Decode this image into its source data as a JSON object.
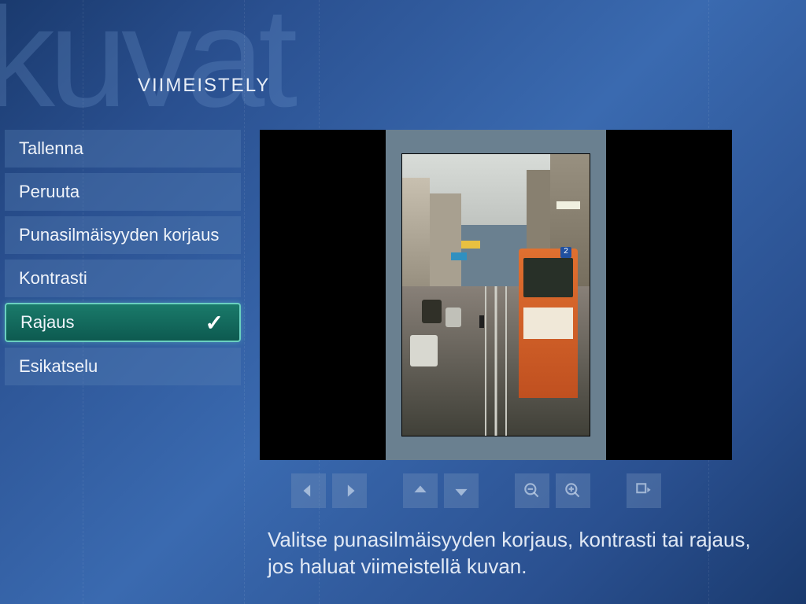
{
  "watermark": "kuvat",
  "pageTitle": "VIIMEISTELY",
  "sidebar": {
    "items": [
      {
        "label": "Tallenna",
        "selected": false
      },
      {
        "label": "Peruuta",
        "selected": false
      },
      {
        "label": "Punasilmäisyyden korjaus",
        "selected": false
      },
      {
        "label": "Kontrasti",
        "selected": false
      },
      {
        "label": "Rajaus",
        "selected": true
      },
      {
        "label": "Esikatselu",
        "selected": false
      }
    ]
  },
  "toolbar": {
    "left": "arrow-left",
    "right": "arrow-right",
    "up": "arrow-up",
    "down": "arrow-down",
    "zoomOut": "zoom-out",
    "zoomIn": "zoom-in",
    "rotate": "rotate"
  },
  "preview": {
    "tramNumber": "2"
  },
  "instructionText": "Valitse punasilmäisyyden korjaus, kontrasti tai rajaus, jos haluat viimeistellä kuvan.",
  "colors": {
    "accent": "#1a7a6a",
    "bgGradientStart": "#1a3a6e",
    "bgGradientEnd": "#3a6ab0"
  }
}
